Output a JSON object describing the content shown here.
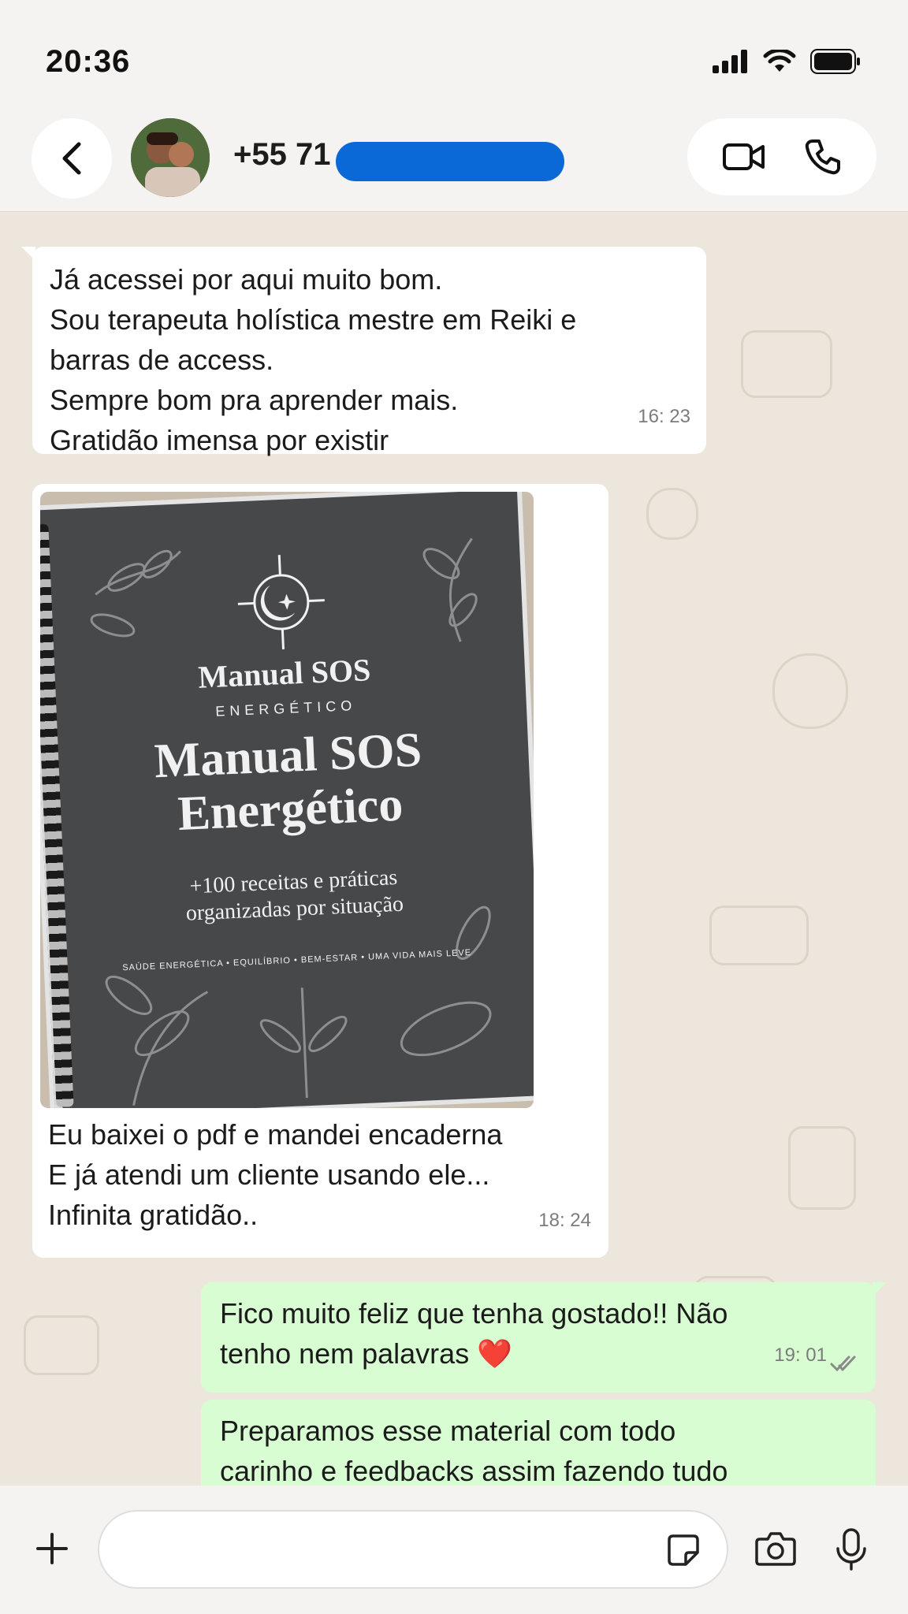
{
  "status": {
    "time": "20:36"
  },
  "header": {
    "contact": "+55 71"
  },
  "messages": [
    {
      "type": "incoming",
      "text": "Já acessei por aqui muito bom.\nSou terapeuta holística mestre em Reiki e\nbarras de access.\nSempre bom pra aprender mais.\nGratidão imensa por existir",
      "time": "16: 23"
    },
    {
      "type": "incoming",
      "text": "Eu baixei o pdf e mandei encaderna\nE já atendi um cliente usando ele...\nInfinita gratidão..",
      "time": "18: 24"
    },
    {
      "type": "outgoing",
      "text": "Fico muito feliz que tenha gostado!! Não\ntenho nem palavras ❤️",
      "time": "19: 01"
    },
    {
      "type": "outgoing",
      "text": "Preparamos esse material com todo\ncarinho e feedbacks assim fazendo tudo"
    }
  ],
  "image": {
    "logo_title": "Manual SOS",
    "logo_sub": "ENERGÉTICO",
    "title_line1": "Manual SOS",
    "title_line2": "Energético",
    "subtitle_line1": "+100 receitas e práticas",
    "subtitle_line2": "organizadas por situação",
    "tagline": "SAÚDE ENERGÉTICA  •  EQUILÍBRIO  •  BEM-ESTAR  •  UMA VIDA MAIS LEVE"
  },
  "colors": {
    "incoming": "#ffffff",
    "outgoing": "#d8fdd2",
    "chat_bg": "#ede6dd",
    "read_ticks": "#8a8a8a"
  }
}
